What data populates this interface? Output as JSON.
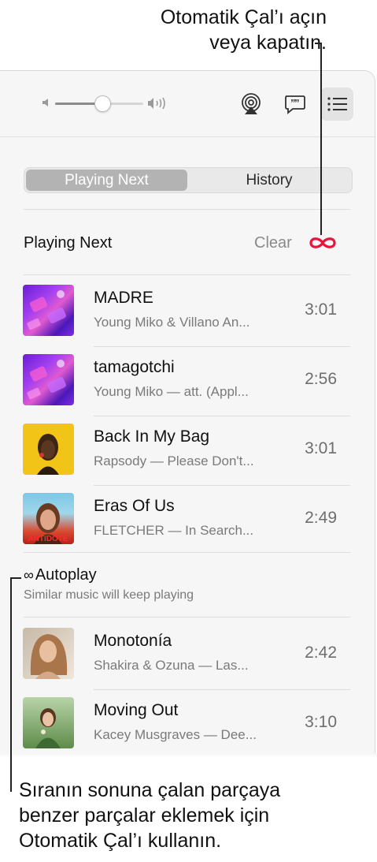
{
  "callouts": {
    "top_line1": "Otomatik Çal’ı açın",
    "top_line2": "veya kapatın.",
    "bottom_line1": "Sıranın sonuna çalan parçaya",
    "bottom_line2": "benzer parçalar eklemek için",
    "bottom_line3": "Otomatik Çal’ı kullanın."
  },
  "toolbar": {
    "volume_level": 0.46,
    "icons": [
      "speaker-low-icon",
      "speaker-high-icon",
      "airplay-icon",
      "lyrics-icon",
      "queue-list-icon"
    ],
    "queue_selected": true
  },
  "tabs": [
    {
      "label": "Playing Next",
      "selected": true
    },
    {
      "label": "History",
      "selected": false
    }
  ],
  "playing_next": {
    "title": "Playing Next",
    "clear_label": "Clear",
    "autoplay_glyph": "∞",
    "autoplay_color": "#e8143c",
    "items": [
      {
        "title": "MADRE",
        "subtitle": "Young Miko & Villano An...",
        "duration": "3:01"
      },
      {
        "title": "tamagotchi",
        "subtitle": "Young Miko — att. (Appl...",
        "duration": "2:56"
      },
      {
        "title": "Back In My Bag",
        "subtitle": "Rapsody — Please Don't...",
        "duration": "3:01"
      },
      {
        "title": "Eras Of Us",
        "subtitle": "FLETCHER — In Search...",
        "duration": "2:49",
        "art_text": "ANTIDOTE"
      }
    ]
  },
  "autoplay": {
    "glyph": "∞",
    "title": "Autoplay",
    "subtitle": "Similar music will keep playing",
    "items": [
      {
        "title": "Monotonía",
        "subtitle": "Shakira & Ozuna — Las...",
        "duration": "2:42"
      },
      {
        "title": "Moving Out",
        "subtitle": "Kacey Musgraves — Dee...",
        "duration": "3:10"
      }
    ]
  }
}
